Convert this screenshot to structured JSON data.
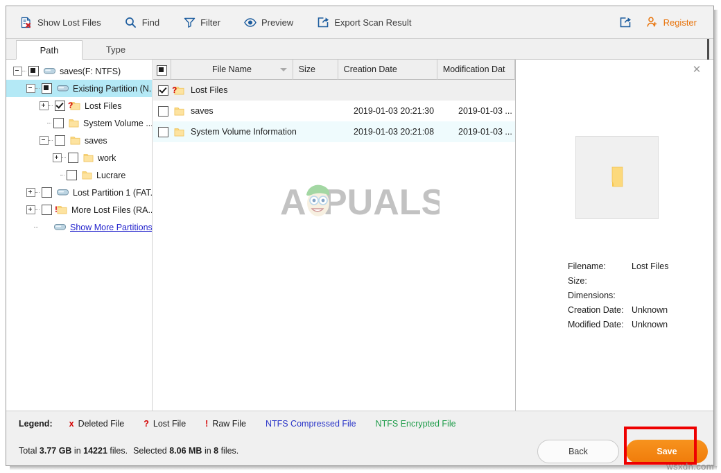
{
  "toolbar": {
    "items": [
      {
        "label": "Show Lost Files",
        "icon": "document-x-icon"
      },
      {
        "label": "Find",
        "icon": "magnifier-icon"
      },
      {
        "label": "Filter",
        "icon": "funnel-icon"
      },
      {
        "label": "Preview",
        "icon": "eye-icon"
      },
      {
        "label": "Export Scan Result",
        "icon": "export-arrow-icon"
      }
    ],
    "share_icon": "share-arrow-icon",
    "register_label": "Register",
    "register_icon": "person-plus-icon",
    "register_color": "#e8740c"
  },
  "tabs": [
    {
      "label": "Path",
      "active": true
    },
    {
      "label": "Type",
      "active": false
    }
  ],
  "tree": {
    "nodes": [
      {
        "label": "saves(F: NTFS)",
        "indent": 0,
        "expander": "minus",
        "check": "filled",
        "icon": "drive-icon",
        "badge": "",
        "selected": false,
        "link": false
      },
      {
        "label": "Existing Partition (N...",
        "indent": 1,
        "expander": "minus",
        "check": "filled",
        "icon": "drive-icon",
        "badge": "",
        "selected": true,
        "link": false
      },
      {
        "label": "Lost Files",
        "indent": 2,
        "expander": "plus",
        "check": "checked",
        "icon": "folder-icon",
        "badge": "?",
        "selected": false,
        "link": false
      },
      {
        "label": "System Volume ...",
        "indent": 2,
        "expander": "none",
        "check": "empty",
        "icon": "folder-icon",
        "badge": "",
        "selected": false,
        "link": false
      },
      {
        "label": "saves",
        "indent": 2,
        "expander": "minus",
        "check": "empty",
        "icon": "folder-icon",
        "badge": "",
        "selected": false,
        "link": false
      },
      {
        "label": "work",
        "indent": 3,
        "expander": "plus",
        "check": "empty",
        "icon": "folder-icon",
        "badge": "",
        "selected": false,
        "link": false
      },
      {
        "label": "Lucrare",
        "indent": 3,
        "expander": "none",
        "check": "empty",
        "icon": "folder-icon",
        "badge": "",
        "selected": false,
        "link": false
      },
      {
        "label": "Lost Partition 1 (FAT...",
        "indent": 1,
        "expander": "plus",
        "check": "empty",
        "icon": "drive-icon",
        "badge": "",
        "selected": false,
        "link": false
      },
      {
        "label": "More Lost Files (RA...",
        "indent": 1,
        "expander": "plus",
        "check": "empty",
        "icon": "folder-icon",
        "badge": "!",
        "selected": false,
        "link": false
      },
      {
        "label": "Show More Partitions",
        "indent": 1,
        "expander": "none",
        "check": "none",
        "icon": "drive-icon",
        "badge": "",
        "selected": false,
        "link": true
      }
    ]
  },
  "filelist": {
    "select_all_state": "filled",
    "columns": [
      {
        "label": "File Name",
        "width": 185,
        "sort": "desc"
      },
      {
        "label": "Size",
        "width": 68,
        "sort": ""
      },
      {
        "label": "Creation Date",
        "width": 151,
        "sort": ""
      },
      {
        "label": "Modification Dat",
        "width": 118,
        "sort": ""
      }
    ],
    "rows": [
      {
        "checked": true,
        "icon": "folder-icon",
        "badge": "?",
        "name": "Lost Files",
        "size": "",
        "creation": "",
        "modification": "",
        "state": "sel"
      },
      {
        "checked": false,
        "icon": "folder-icon",
        "badge": "",
        "name": "saves",
        "size": "",
        "creation": "2019-01-03 20:21:30",
        "modification": "2019-01-03 ...",
        "state": ""
      },
      {
        "checked": false,
        "icon": "folder-icon",
        "badge": "",
        "name": "System Volume Information",
        "size": "",
        "creation": "2019-01-03 20:21:08",
        "modification": "2019-01-03 ...",
        "state": "alt"
      }
    ]
  },
  "preview": {
    "close_icon": "close-icon",
    "thumb_icon": "folder-icon",
    "fields": [
      {
        "key": "Filename:",
        "value": "Lost Files"
      },
      {
        "key": "Size:",
        "value": ""
      },
      {
        "key": "Dimensions:",
        "value": ""
      },
      {
        "key": "Creation Date:",
        "value": "Unknown"
      },
      {
        "key": "Modified Date:",
        "value": "Unknown"
      }
    ]
  },
  "legend": {
    "title": "Legend:",
    "items": [
      {
        "mark": "x",
        "label": "Deleted File",
        "mark_color": "#d40000",
        "label_color": "#1c1c1c"
      },
      {
        "mark": "?",
        "label": "Lost File",
        "mark_color": "#d40000",
        "label_color": "#1c1c1c"
      },
      {
        "mark": "!",
        "label": "Raw File",
        "mark_color": "#d40000",
        "label_color": "#1c1c1c"
      },
      {
        "mark": "",
        "label": "NTFS Compressed File",
        "mark_color": "",
        "label_color": "#2b36c8"
      },
      {
        "mark": "",
        "label": "NTFS Encrypted File",
        "mark_color": "",
        "label_color": "#1f9c4a"
      }
    ]
  },
  "status": {
    "total_prefix": "Total ",
    "total_size": "3.77 GB",
    "total_mid": " in ",
    "total_count": "14221",
    "total_suffix": " files.",
    "selected_prefix": "Selected ",
    "selected_size": "8.06 MB",
    "selected_mid": " in ",
    "selected_count": "8",
    "selected_suffix": " files."
  },
  "footer": {
    "back_label": "Back",
    "save_label": "Save",
    "save_color": "#f07b0a",
    "highlight_color": "#ee0000"
  },
  "watermarks": {
    "center": "APPUALS",
    "corner": "wsxdn.com"
  }
}
